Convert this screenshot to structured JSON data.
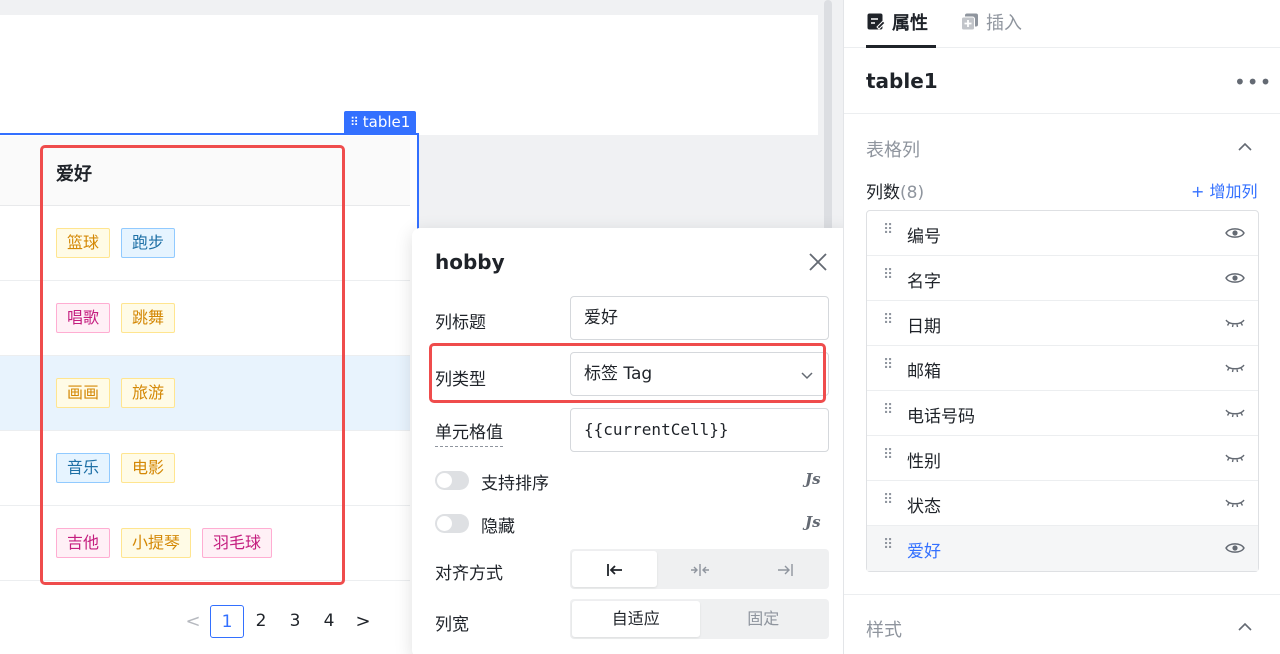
{
  "canvas": {
    "table_tag": "table1",
    "table": {
      "header": "爱好",
      "rows": [
        {
          "tags": [
            {
              "text": "篮球",
              "color": "orange"
            },
            {
              "text": "跑步",
              "color": "blue"
            }
          ],
          "highlighted": false
        },
        {
          "tags": [
            {
              "text": "唱歌",
              "color": "pink"
            },
            {
              "text": "跳舞",
              "color": "orange"
            }
          ],
          "highlighted": false
        },
        {
          "tags": [
            {
              "text": "画画",
              "color": "orange"
            },
            {
              "text": "旅游",
              "color": "orange"
            }
          ],
          "highlighted": true
        },
        {
          "tags": [
            {
              "text": "音乐",
              "color": "blue"
            },
            {
              "text": "电影",
              "color": "orange"
            }
          ],
          "highlighted": false
        },
        {
          "tags": [
            {
              "text": "吉他",
              "color": "pink"
            },
            {
              "text": "小提琴",
              "color": "orange"
            },
            {
              "text": "羽毛球",
              "color": "pink"
            }
          ],
          "highlighted": false
        }
      ]
    },
    "pagination": {
      "pages": [
        "1",
        "2",
        "3",
        "4"
      ],
      "current": "1",
      "prev": "<",
      "next": ">"
    }
  },
  "popup": {
    "title": "hobby",
    "column_title_label": "列标题",
    "column_title_value": "爱好",
    "column_type_label": "列类型",
    "column_type_value": "标签 Tag",
    "cell_value_label": "单元格值",
    "cell_value_value": "{{currentCell}}",
    "sortable_label": "支持排序",
    "hidden_label": "隐藏",
    "js_badge": "Js",
    "align_label": "对齐方式",
    "align_options": [
      "left",
      "center",
      "right"
    ],
    "align_selected": "left",
    "width_label": "列宽",
    "width_options": [
      "自适应",
      "固定"
    ],
    "width_selected": "自适应"
  },
  "panel": {
    "tabs": [
      {
        "label": "属性",
        "active": true
      },
      {
        "label": "插入",
        "active": false
      }
    ],
    "component_name": "table1",
    "more": "•••",
    "columns_section_title": "表格列",
    "column_count_label": "列数",
    "column_count": "(8)",
    "add_column": "+ 增加列",
    "columns": [
      {
        "label": "编号",
        "visible": true,
        "selected": false
      },
      {
        "label": "名字",
        "visible": true,
        "selected": false
      },
      {
        "label": "日期",
        "visible": false,
        "selected": false
      },
      {
        "label": "邮箱",
        "visible": false,
        "selected": false
      },
      {
        "label": "电话号码",
        "visible": false,
        "selected": false
      },
      {
        "label": "性别",
        "visible": false,
        "selected": false
      },
      {
        "label": "状态",
        "visible": false,
        "selected": false
      },
      {
        "label": "爱好",
        "visible": true,
        "selected": true
      }
    ],
    "style_section_title": "样式"
  },
  "colors": {
    "accent": "#3370ff",
    "highlight_red": "#ef4c4c",
    "row_highlight": "#e8f3fd"
  }
}
